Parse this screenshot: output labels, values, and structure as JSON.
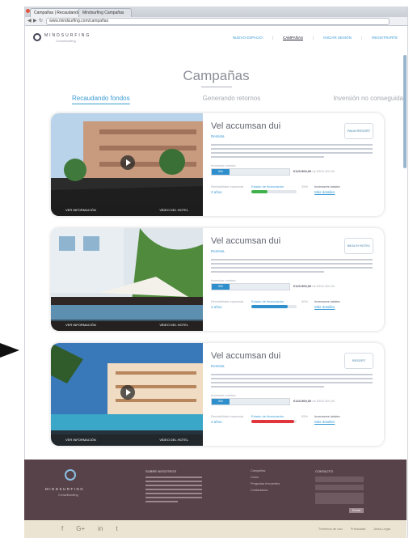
{
  "browser": {
    "tabs": [
      "Campañas | Recaudando fondos",
      "Mindsurfing Campañas"
    ],
    "url": "www.mindsurfing.com/campañas"
  },
  "header": {
    "logo_text": "MINDSURFING",
    "logo_sub": "Crowdfunding",
    "menu": [
      "NUEVO ESPACIO",
      "CAMPAÑAS",
      "INICIAR SESIÓN",
      "REGISTRARTE"
    ]
  },
  "page": {
    "title": "Campañas",
    "tabs": [
      "Recaudando fondos",
      "Generando retornos",
      "Inversión no conseguida"
    ]
  },
  "cards": [
    {
      "name": "Vel accumsan dui",
      "type": "Rentista",
      "brand": "PALM RESORT",
      "min_label": "Inversión mínima",
      "min_value": "500",
      "amount": "€123.500,00",
      "amount_note": "de €300.000,00",
      "stat1_label": "Rentabilidad esperada",
      "stat1_value": "3 años",
      "stat2_label": "Estado de financiación",
      "progress": 0.35,
      "progress_color": "#3fb24b",
      "stat3_label": "35%",
      "stat4_label": "Inversores totales",
      "stat4_value": "Más detalles",
      "caption_left": "VER INFORMACIÓN",
      "caption_right": "VÍDEO DEL HOTEL"
    },
    {
      "name": "Vel accumsan dui",
      "type": "Rentista",
      "brand": "BEACH HOTEL",
      "min_label": "Inversión mínima",
      "min_value": "500",
      "amount": "€123.500,00",
      "amount_note": "de €300.000,00",
      "stat1_label": "Rentabilidad esperada",
      "stat1_value": "3 años",
      "stat2_label": "Estado de financiación",
      "progress": 0.8,
      "progress_color": "#2e8fcc",
      "stat3_label": "80%",
      "stat4_label": "Inversores totales",
      "stat4_value": "Más detalles",
      "caption_left": "VER INFORMACIÓN",
      "caption_right": "VÍDEO DEL HOTEL"
    },
    {
      "name": "Vel accumsan dui",
      "type": "Rentista",
      "brand": "RESORT",
      "min_label": "Inversión mínima",
      "min_value": "500",
      "amount": "€123.500,00",
      "amount_note": "de €300.000,00",
      "stat1_label": "Rentabilidad esperada",
      "stat1_value": "3 años",
      "stat2_label": "Estado de financiación",
      "progress": 0.95,
      "progress_color": "#e2363e",
      "stat3_label": "95%",
      "stat4_label": "Inversores totales",
      "stat4_value": "Más detalles",
      "caption_left": "VER INFORMACIÓN",
      "caption_right": "VÍDEO DEL HOTEL"
    }
  ],
  "footer": {
    "brand": "MINDSURFING",
    "brand_sub": "Crowdfunding",
    "col1_head": "SOBRE NOSOTROS",
    "col2_links": [
      "Campañas",
      "Cómo",
      "Preguntas frecuentes",
      "Contáctanos"
    ],
    "col3_head": "CONTACTO",
    "send": "Enviar",
    "social": [
      "f",
      "G+",
      "in",
      "t"
    ],
    "legal": [
      "Términos de uso",
      "Privacidad",
      "Aviso Legal"
    ]
  },
  "colors": {
    "accent": "#3c9bd6",
    "footer_bg": "#564248",
    "bottom_bg": "#ece4d2"
  }
}
